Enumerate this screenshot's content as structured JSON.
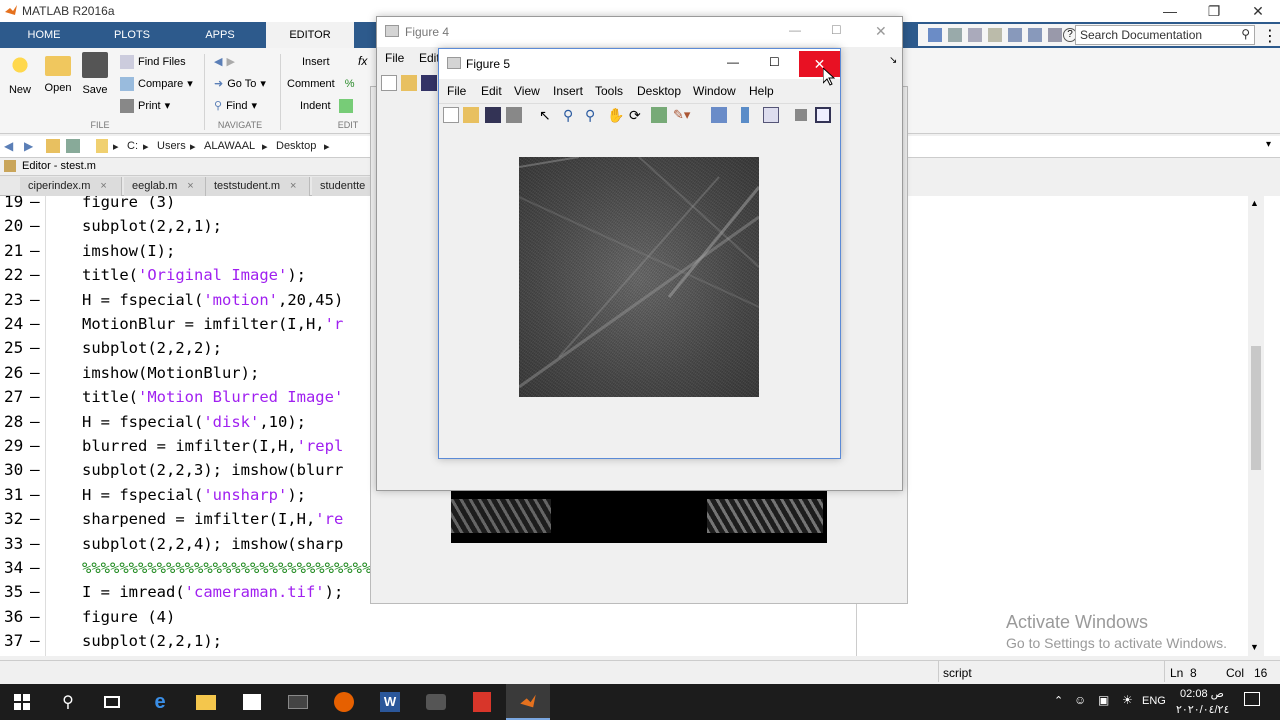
{
  "window": {
    "title": "MATLAB R2016a"
  },
  "ribbon": {
    "tabs": [
      "HOME",
      "PLOTS",
      "APPS",
      "EDITOR"
    ],
    "file": {
      "new": "New",
      "open": "Open",
      "save": "Save",
      "find_files": "Find Files",
      "compare": "Compare",
      "print": "Print",
      "group": "FILE"
    },
    "navigate": {
      "go_to": "Go To",
      "find": "Find",
      "group": "NAVIGATE"
    },
    "edit": {
      "insert": "Insert",
      "comment": "Comment",
      "indent": "Indent",
      "group": "EDIT",
      "fx": "fx"
    }
  },
  "search": {
    "placeholder": "Search Documentation"
  },
  "address": {
    "drive": "C:",
    "parts": [
      "Users",
      "ALAWAAL",
      "Desktop"
    ]
  },
  "editor": {
    "header": "Editor - stest.m",
    "tabs": [
      "ciperindex.m",
      "eeglab.m",
      "teststudent.m",
      "studentte"
    ],
    "lines": [
      {
        "n": "19",
        "code": "figure (3)"
      },
      {
        "n": "20",
        "code": "subplot(2,2,1);"
      },
      {
        "n": "21",
        "code": "imshow(I);"
      },
      {
        "n": "22",
        "pre": "title(",
        "str": "'Original Image'",
        "post": ");"
      },
      {
        "n": "23",
        "pre": "H = fspecial(",
        "str": "'motion'",
        "post": ",20,45)"
      },
      {
        "n": "24",
        "pre": "MotionBlur = imfilter(I,H,",
        "str": "'r",
        "post": ""
      },
      {
        "n": "25",
        "code": "subplot(2,2,2);"
      },
      {
        "n": "26",
        "code": "imshow(MotionBlur);"
      },
      {
        "n": "27",
        "pre": "title(",
        "str": "'Motion Blurred Image'",
        "post": ""
      },
      {
        "n": "28",
        "pre": "H = fspecial(",
        "str": "'disk'",
        "post": ",10);"
      },
      {
        "n": "29",
        "pre": "blurred = imfilter(I,H,",
        "str": "'repl",
        "post": ""
      },
      {
        "n": "30",
        "code": "subplot(2,2,3); imshow(blurr"
      },
      {
        "n": "31",
        "pre": "H = fspecial(",
        "str": "'unsharp'",
        "post": ");"
      },
      {
        "n": "32",
        "pre": "sharpened = imfilter(I,H,",
        "str": "'re",
        "post": ""
      },
      {
        "n": "33",
        "code": "subplot(2,2,4); imshow(sharp"
      },
      {
        "n": "34",
        "cmt": "%%%%%%%%%%%%%%%%%%%%%%%%%%%%%%%%%%%%%%%%"
      },
      {
        "n": "35",
        "pre": "I = imread(",
        "str": "'cameraman.tif'",
        "post": ");"
      },
      {
        "n": "36",
        "code": "figure (4)"
      },
      {
        "n": "37",
        "code": "subplot(2,2,1);"
      }
    ]
  },
  "status": {
    "mode": "script",
    "ln_label": "Ln",
    "ln": "8",
    "col_label": "Col",
    "col": "16"
  },
  "figure4": {
    "title": "Figure 4",
    "menu": [
      "File",
      "Edit"
    ]
  },
  "figure5": {
    "title": "Figure 5",
    "menu": [
      "File",
      "Edit",
      "View",
      "Insert",
      "Tools",
      "Desktop",
      "Window",
      "Help"
    ]
  },
  "watermark": {
    "line1": "Activate Windows",
    "line2": "Go to Settings to activate Windows."
  },
  "taskbar": {
    "lang": "ENG",
    "time": "02:08 ص",
    "date": "٢٠٢٠/٠٤/٢٤"
  },
  "colors": {
    "ribbon_blue": "#2d5a8c",
    "close_red": "#e81123",
    "string_purple": "#a020f0",
    "comment_green": "#228b22"
  }
}
